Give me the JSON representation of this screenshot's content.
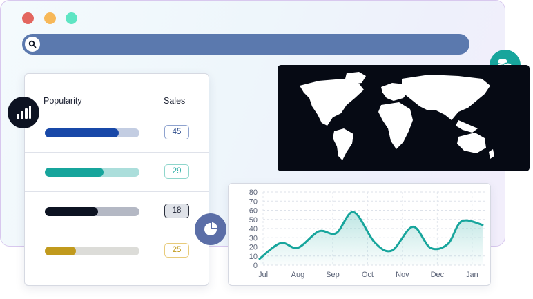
{
  "window": {
    "controls": [
      "close",
      "minimize",
      "maximize"
    ],
    "search": {
      "icon": "search-icon",
      "value": ""
    }
  },
  "icons": {
    "coins": "coins-icon",
    "bar_chart": "bar-chart-icon",
    "pie_chart": "pie-chart-icon"
  },
  "popularity_table": {
    "headers": {
      "popularity": "Popularity",
      "sales": "Sales"
    },
    "rows": [
      {
        "popularity": 0.78,
        "sales": "45",
        "fill": "#1848a8",
        "track": "#c3cde2",
        "badge_border": "#8fa3cf",
        "badge_text": "#2b4a8a",
        "badge_bg": "#ffffff"
      },
      {
        "popularity": 0.62,
        "sales": "29",
        "fill": "#17a59c",
        "track": "#abdedb",
        "badge_border": "#8fd6cc",
        "badge_text": "#17a59c",
        "badge_bg": "#ffffff"
      },
      {
        "popularity": 0.56,
        "sales": "18",
        "fill": "#0d1322",
        "track": "#b4b8c4",
        "badge_border": "#2a2f3c",
        "badge_text": "#1d2233",
        "badge_bg": "#dfe2e8"
      },
      {
        "popularity": 0.33,
        "sales": "25",
        "fill": "#c19a1d",
        "track": "#dcdcd8",
        "badge_border": "#e8cb7a",
        "badge_text": "#c19a1d",
        "badge_bg": "#ffffff"
      }
    ]
  },
  "map": {
    "background": "#060a14",
    "land_color": "#ffffff"
  },
  "colors": {
    "accent_teal": "#17a59c",
    "search_bar": "#5b79ae",
    "dark": "#0d1322"
  },
  "chart_data": {
    "type": "area",
    "x_tick_labels": [
      "Jul",
      "Aug",
      "Sep",
      "Oct",
      "Nov",
      "Dec",
      "Jan"
    ],
    "y_tick_labels": [
      "80",
      "70",
      "60",
      "50",
      "40",
      "30",
      "20",
      "10",
      "0"
    ],
    "y_ticks": [
      80,
      70,
      60,
      50,
      40,
      30,
      20,
      10,
      0
    ],
    "ylim": [
      0,
      80
    ],
    "xlim": [
      0,
      6.4
    ],
    "grid": true,
    "line_color": "#17a59c",
    "points": [
      {
        "x": -0.1,
        "y": 7
      },
      {
        "x": 0.5,
        "y": 24
      },
      {
        "x": 1.0,
        "y": 19
      },
      {
        "x": 1.6,
        "y": 37
      },
      {
        "x": 2.1,
        "y": 35
      },
      {
        "x": 2.6,
        "y": 58
      },
      {
        "x": 3.2,
        "y": 25
      },
      {
        "x": 3.7,
        "y": 16
      },
      {
        "x": 4.3,
        "y": 42
      },
      {
        "x": 4.8,
        "y": 19
      },
      {
        "x": 5.3,
        "y": 23
      },
      {
        "x": 5.7,
        "y": 48
      },
      {
        "x": 6.3,
        "y": 44
      }
    ]
  }
}
